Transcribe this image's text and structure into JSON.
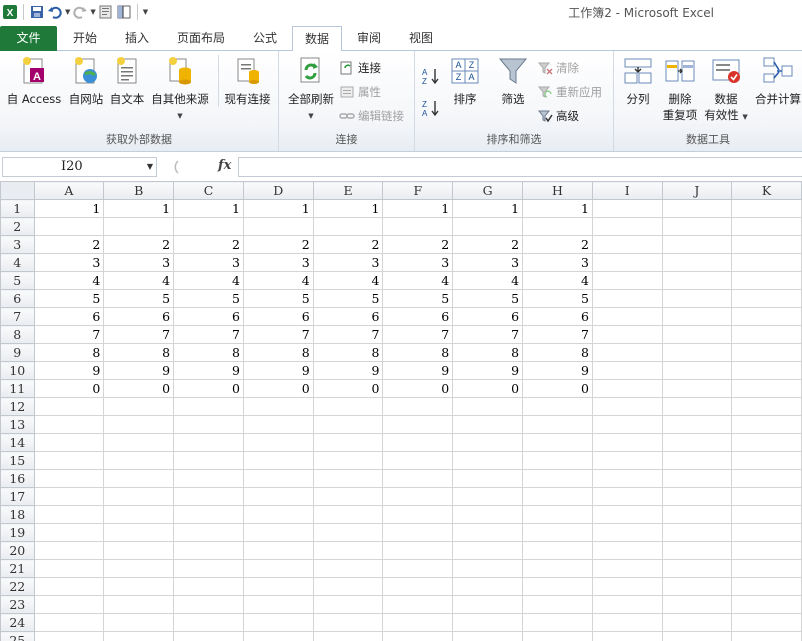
{
  "window": {
    "title": "工作簿2 - Microsoft Excel"
  },
  "tabs": [
    {
      "id": "file",
      "label": "文件"
    },
    {
      "id": "home",
      "label": "开始"
    },
    {
      "id": "insert",
      "label": "插入"
    },
    {
      "id": "layout",
      "label": "页面布局"
    },
    {
      "id": "formulas",
      "label": "公式"
    },
    {
      "id": "data",
      "label": "数据"
    },
    {
      "id": "review",
      "label": "审阅"
    },
    {
      "id": "view",
      "label": "视图"
    }
  ],
  "ribbon": {
    "external": {
      "label": "获取外部数据",
      "access": "自 Access",
      "web": "自网站",
      "text": "自文本",
      "other": "自其他来源",
      "existing": "现有连接"
    },
    "connections": {
      "label": "连接",
      "refresh_all": "全部刷新",
      "connections": "连接",
      "properties": "属性",
      "edit_links": "编辑链接"
    },
    "sort": {
      "label": "排序和筛选",
      "sort": "排序",
      "filter": "筛选",
      "clear": "清除",
      "reapply": "重新应用",
      "advanced": "高级"
    },
    "tools": {
      "label": "数据工具",
      "split": "分列",
      "remove_dup_1": "删除",
      "remove_dup_2": "重复项",
      "validation_1": "数据",
      "validation_2": "有效性",
      "consolidate": "合并计算"
    }
  },
  "formula_bar": {
    "name_box": "I20",
    "fx": "fx",
    "value": ""
  },
  "grid": {
    "columns": [
      "A",
      "B",
      "C",
      "D",
      "E",
      "F",
      "G",
      "H",
      "I",
      "J",
      "K"
    ],
    "rows": [
      [
        "1",
        "1",
        "1",
        "1",
        "1",
        "1",
        "1",
        "1",
        "",
        "",
        ""
      ],
      [
        "",
        "",
        "",
        "",
        "",
        "",
        "",
        "",
        "",
        "",
        ""
      ],
      [
        "2",
        "2",
        "2",
        "2",
        "2",
        "2",
        "2",
        "2",
        "",
        "",
        ""
      ],
      [
        "3",
        "3",
        "3",
        "3",
        "3",
        "3",
        "3",
        "3",
        "",
        "",
        ""
      ],
      [
        "4",
        "4",
        "4",
        "4",
        "4",
        "4",
        "4",
        "4",
        "",
        "",
        ""
      ],
      [
        "5",
        "5",
        "5",
        "5",
        "5",
        "5",
        "5",
        "5",
        "",
        "",
        ""
      ],
      [
        "6",
        "6",
        "6",
        "6",
        "6",
        "6",
        "6",
        "6",
        "",
        "",
        ""
      ],
      [
        "7",
        "7",
        "7",
        "7",
        "7",
        "7",
        "7",
        "7",
        "",
        "",
        ""
      ],
      [
        "8",
        "8",
        "8",
        "8",
        "8",
        "8",
        "8",
        "8",
        "",
        "",
        ""
      ],
      [
        "9",
        "9",
        "9",
        "9",
        "9",
        "9",
        "9",
        "9",
        "",
        "",
        ""
      ],
      [
        "0",
        "0",
        "0",
        "0",
        "0",
        "0",
        "0",
        "0",
        "",
        "",
        ""
      ],
      [
        "",
        "",
        "",
        "",
        "",
        "",
        "",
        "",
        "",
        "",
        ""
      ],
      [
        "",
        "",
        "",
        "",
        "",
        "",
        "",
        "",
        "",
        "",
        ""
      ],
      [
        "",
        "",
        "",
        "",
        "",
        "",
        "",
        "",
        "",
        "",
        ""
      ],
      [
        "",
        "",
        "",
        "",
        "",
        "",
        "",
        "",
        "",
        "",
        ""
      ],
      [
        "",
        "",
        "",
        "",
        "",
        "",
        "",
        "",
        "",
        "",
        ""
      ],
      [
        "",
        "",
        "",
        "",
        "",
        "",
        "",
        "",
        "",
        "",
        ""
      ],
      [
        "",
        "",
        "",
        "",
        "",
        "",
        "",
        "",
        "",
        "",
        ""
      ],
      [
        "",
        "",
        "",
        "",
        "",
        "",
        "",
        "",
        "",
        "",
        ""
      ],
      [
        "",
        "",
        "",
        "",
        "",
        "",
        "",
        "",
        "",
        "",
        ""
      ],
      [
        "",
        "",
        "",
        "",
        "",
        "",
        "",
        "",
        "",
        "",
        ""
      ],
      [
        "",
        "",
        "",
        "",
        "",
        "",
        "",
        "",
        "",
        "",
        ""
      ],
      [
        "",
        "",
        "",
        "",
        "",
        "",
        "",
        "",
        "",
        "",
        ""
      ],
      [
        "",
        "",
        "",
        "",
        "",
        "",
        "",
        "",
        "",
        "",
        ""
      ],
      [
        "",
        "",
        "",
        "",
        "",
        "",
        "",
        "",
        "",
        "",
        ""
      ]
    ]
  },
  "colors": {
    "file_tab": "#1f7a39",
    "header_border": "#b8c7da"
  }
}
